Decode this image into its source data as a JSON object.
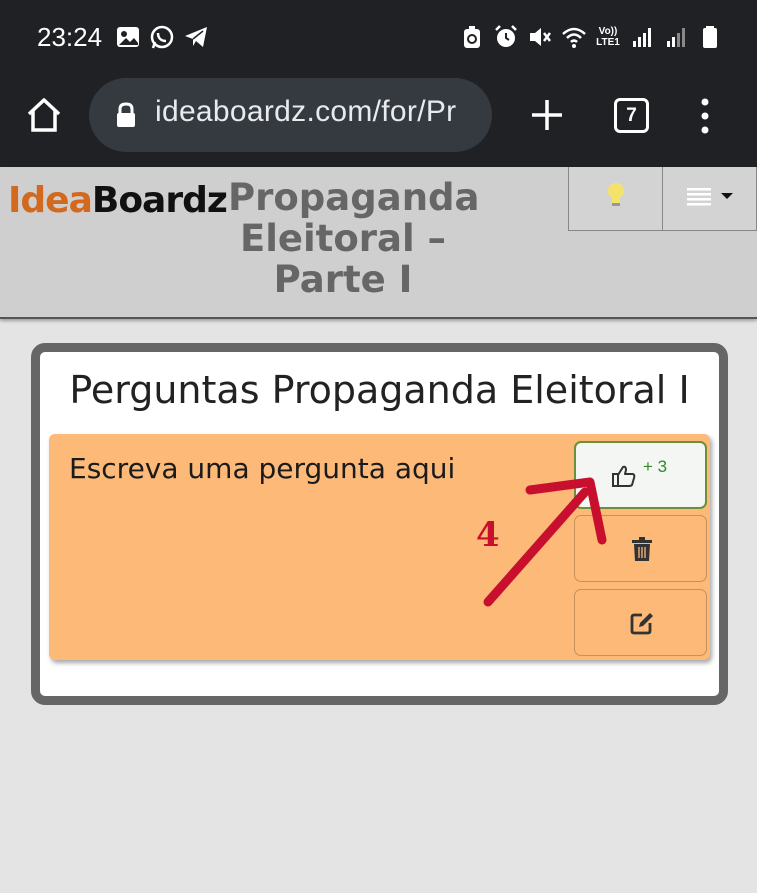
{
  "status_bar": {
    "time": "23:24",
    "left_icons": [
      "image-icon",
      "whatsapp-icon",
      "telegram-icon"
    ],
    "right_icons": [
      "data-saver-icon",
      "alarm-icon",
      "mute-icon",
      "wifi-icon",
      "volte-icon",
      "signal-icon",
      "signal-icon-2",
      "battery-icon"
    ],
    "volte_top": "Vo))",
    "volte_bottom": "LTE1"
  },
  "browser": {
    "url": "ideaboardz.com/for/Pr",
    "tab_count": "7"
  },
  "header": {
    "logo_part1": "Idea",
    "logo_part2": "Boardz",
    "board_title": "Propaganda Eleitoral – Parte I",
    "idea_button_icon": "lightbulb-icon",
    "menu_button_icon": "hamburger-dropdown-icon"
  },
  "section": {
    "title": "Perguntas Propaganda Eleitoral I"
  },
  "sticky": {
    "text": "Escreva uma pergunta aqui",
    "like_count": "+ 3",
    "like_icon": "thumbs-up-icon",
    "delete_icon": "trash-icon",
    "edit_icon": "edit-icon"
  },
  "annotation": {
    "number": "4",
    "color": "#c8102e"
  },
  "colors": {
    "sticky_bg": "#fdb978",
    "like_border": "#6b8f3b",
    "logo_accent": "#d2691e"
  }
}
